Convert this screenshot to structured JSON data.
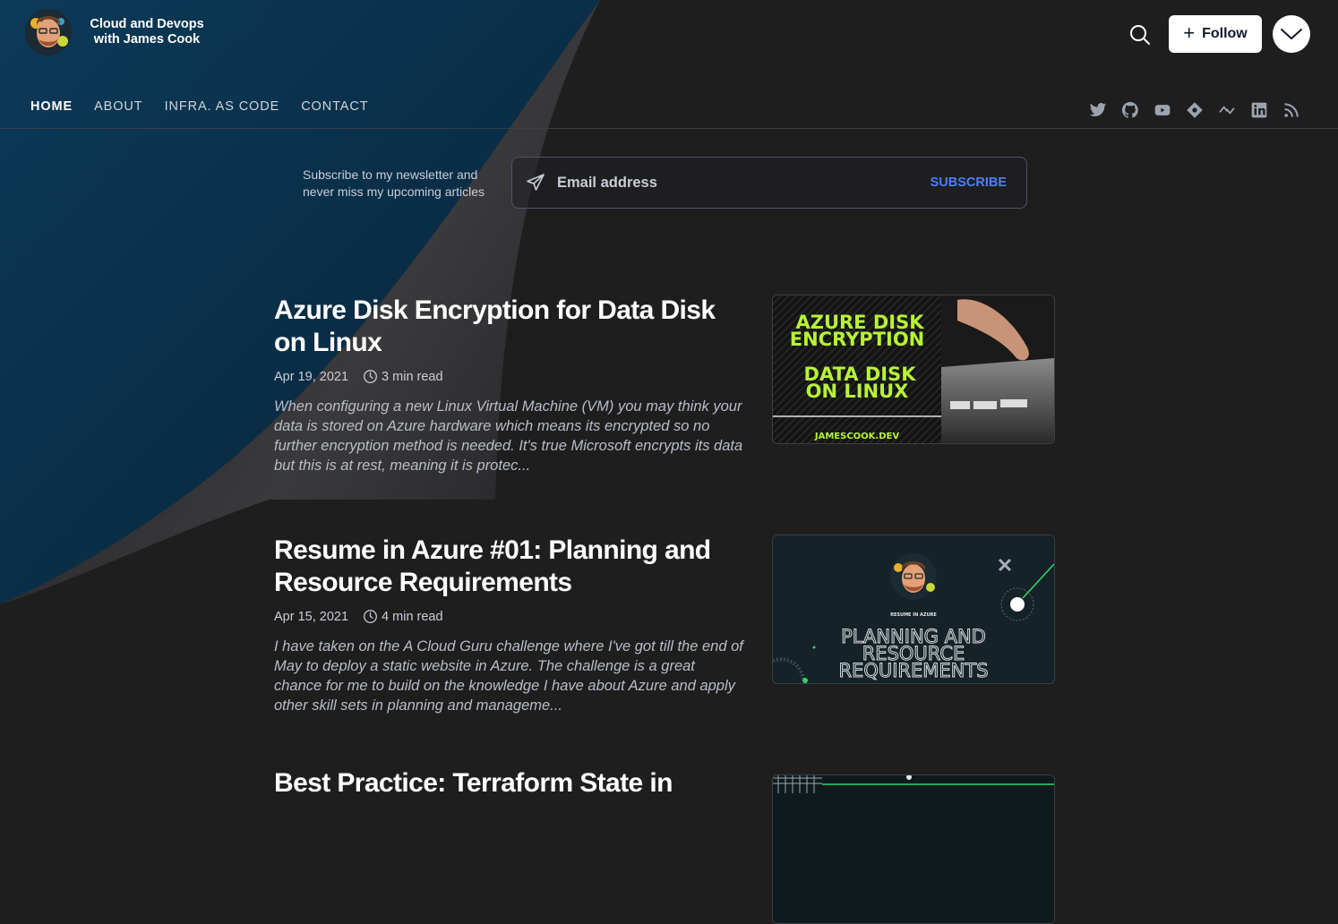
{
  "header": {
    "blog_title": "Cloud and Devops with James Cook",
    "follow_label": "Follow"
  },
  "nav": {
    "items": [
      {
        "label": "HOME",
        "active": true
      },
      {
        "label": "ABOUT",
        "active": false
      },
      {
        "label": "INFRA. AS CODE",
        "active": false
      },
      {
        "label": "CONTACT",
        "active": false
      }
    ]
  },
  "socials": [
    "twitter-icon",
    "github-icon",
    "youtube-icon",
    "hashnode-icon",
    "devto-icon",
    "linkedin-icon",
    "rss-icon"
  ],
  "newsletter": {
    "text": "Subscribe to my newsletter and never miss my upcoming articles",
    "placeholder": "Email address",
    "button_label": "SUBSCRIBE"
  },
  "articles": [
    {
      "title": "Azure Disk Encryption for Data Disk on Linux",
      "date": "Apr 19, 2021",
      "read_time": "3 min read",
      "excerpt": "When configuring a new Linux Virtual Machine (VM) you may think your data is stored on Azure hardware which means its encrypted so no further encryption method is needed. It's true Microsoft encrypts its data but this is at rest, meaning it is protec...",
      "thumbnail": {
        "line1": "AZURE DISK",
        "line2": "ENCRYPTION",
        "line3": "DATA DISK",
        "line4": "ON LINUX",
        "footer": "JAMESCOOK.DEV"
      }
    },
    {
      "title": "Resume in Azure #01: Planning and Resource Requirements",
      "date": "Apr 15, 2021",
      "read_time": "4 min read",
      "excerpt": "I have taken on the A Cloud Guru challenge where I've got till the end of May to deploy a static website in Azure. The challenge is a great chance for me to build on the knowledge I have about Azure and apply other skill sets in planning and manageme...",
      "thumbnail": {
        "caption": "RESUME IN AZURE",
        "line1": "PLANNING AND",
        "line2": "RESOURCE",
        "line3": "REQUIREMENTS"
      }
    },
    {
      "title": "Best Practice: Terraform State in"
    }
  ],
  "colors": {
    "accent": "#4f7df6",
    "background": "#1e1e1f",
    "thumb_green": "#b7f239"
  }
}
